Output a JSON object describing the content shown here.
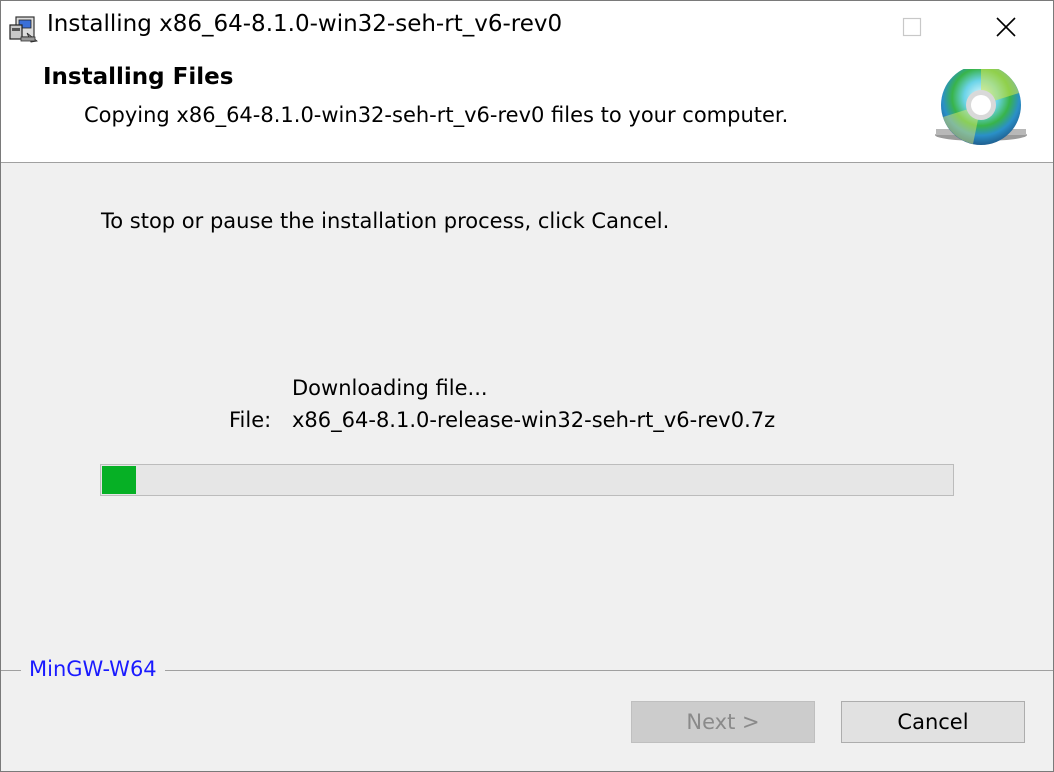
{
  "window": {
    "title": "Installing x86_64-8.1.0-win32-seh-rt_v6-rev0",
    "icon": "installer-icon"
  },
  "header": {
    "title": "Installing Files",
    "subtitle": "Copying x86_64-8.1.0-win32-seh-rt_v6-rev0 files to your computer.",
    "icon": "cd-disc-icon"
  },
  "body": {
    "instruction": "To stop or pause the installation process, click Cancel.",
    "status": "Downloading file...",
    "file_label": "File:",
    "file_name": "x86_64-8.1.0-release-win32-seh-rt_v6-rev0.7z",
    "progress_percent": 4
  },
  "brand": {
    "text": "MinGW-W64",
    "color": "#1a1aff"
  },
  "buttons": {
    "next_label": "Next >",
    "next_enabled": false,
    "cancel_label": "Cancel"
  },
  "colors": {
    "progress_fill": "#06b025",
    "progress_track": "#e6e6e6"
  }
}
